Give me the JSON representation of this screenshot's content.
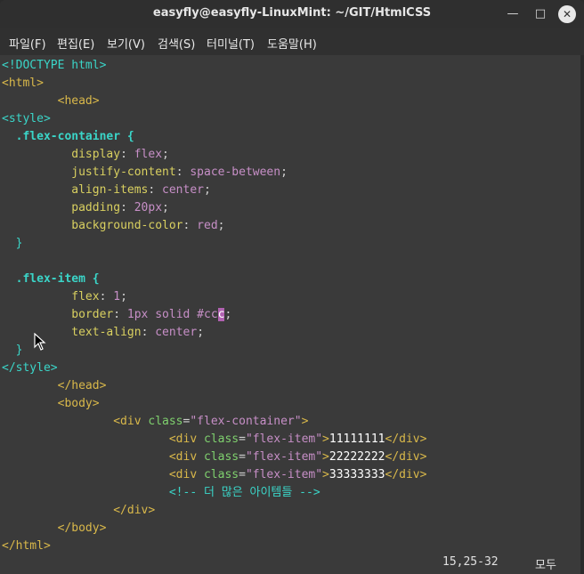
{
  "window": {
    "title": "easyfly@easyfly-LinuxMint: ~/GIT/HtmlCSS",
    "minimize_icon": "minimize-icon",
    "maximize_icon": "maximize-icon",
    "close_icon": "close-icon"
  },
  "menu": {
    "file": "파일(F)",
    "edit": "편집(E)",
    "view": "보기(V)",
    "search": "검색(S)",
    "terminal": "터미널(T)",
    "help": "도움말(H)"
  },
  "code": {
    "l1": "<!DOCTYPE html>",
    "l2": "<html>",
    "l3_tag": "<head>",
    "l4": "<style>",
    "l5_sel": ".flex-container",
    "l5_brace": " {",
    "l6_prop": "display",
    "l6_val": "flex",
    "l7_prop": "justify-content",
    "l7_val": "space-between",
    "l8_prop": "align-items",
    "l8_val": "center",
    "l9_prop": "padding",
    "l9_val": "20px",
    "l10_prop": "background-color",
    "l10_val": "red",
    "l11": "}",
    "l13_sel": ".flex-item",
    "l13_brace": " {",
    "l14_prop": "flex",
    "l14_val": "1",
    "l15_prop": "border",
    "l15_val_a": "1px solid #cc",
    "l15_val_cursor": "c",
    "l16_prop": "text-align",
    "l16_val": "center",
    "l17": "}",
    "l18": "</style>",
    "l19": "</head>",
    "l20": "<body>",
    "l21_open": "<div",
    "l21_attr": "class",
    "l21_str": "\"flex-container\"",
    "l21_close": ">",
    "l22_text": "11111111",
    "l23_text": "22222222",
    "l24_text": "33333333",
    "item_open": "<div",
    "item_attr": "class",
    "item_str": "\"flex-item\"",
    "item_gt": ">",
    "item_close": "</div>",
    "l25": "<!-- 더 많은 아이템들 -->",
    "l26": "</div>",
    "l27": "</body>",
    "l28": "</html>"
  },
  "status": {
    "position": "15,25-32",
    "scroll": "모두"
  }
}
